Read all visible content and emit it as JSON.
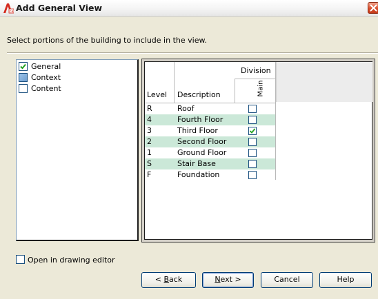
{
  "window": {
    "title": "Add General View",
    "app_icon": "autocad-architecture-icon"
  },
  "instruction": "Select portions of the building to include in the view.",
  "categories": [
    {
      "label": "General",
      "checked": true
    },
    {
      "label": "Context",
      "checked": false,
      "highlighted": true
    },
    {
      "label": "Content",
      "checked": false
    }
  ],
  "grid": {
    "group_header": "Division",
    "columns": {
      "level": "Level",
      "description": "Description",
      "division": "Main"
    },
    "rows": [
      {
        "level": "R",
        "description": "Roof",
        "checked": false,
        "highlighted": false
      },
      {
        "level": "4",
        "description": "Fourth Floor",
        "checked": false,
        "highlighted": true
      },
      {
        "level": "3",
        "description": "Third Floor",
        "checked": true,
        "highlighted": false
      },
      {
        "level": "2",
        "description": "Second Floor",
        "checked": false,
        "highlighted": true
      },
      {
        "level": "1",
        "description": "Ground Floor",
        "checked": false,
        "highlighted": false
      },
      {
        "level": "S",
        "description": "Stair Base",
        "checked": false,
        "highlighted": true
      },
      {
        "level": "F",
        "description": "Foundation",
        "checked": false,
        "highlighted": false
      }
    ]
  },
  "open_in_editor": {
    "label": "Open in drawing editor",
    "checked": false
  },
  "buttons": {
    "back_prefix": "< ",
    "back_mnemonic": "B",
    "back_rest": "ack",
    "next_mnemonic": "N",
    "next_rest": "ext >",
    "cancel": "Cancel",
    "help": "Help"
  },
  "colors": {
    "row_highlight": "#cbe8d8",
    "dialog_bg": "#ece9d8",
    "check_green": "#21a121"
  }
}
